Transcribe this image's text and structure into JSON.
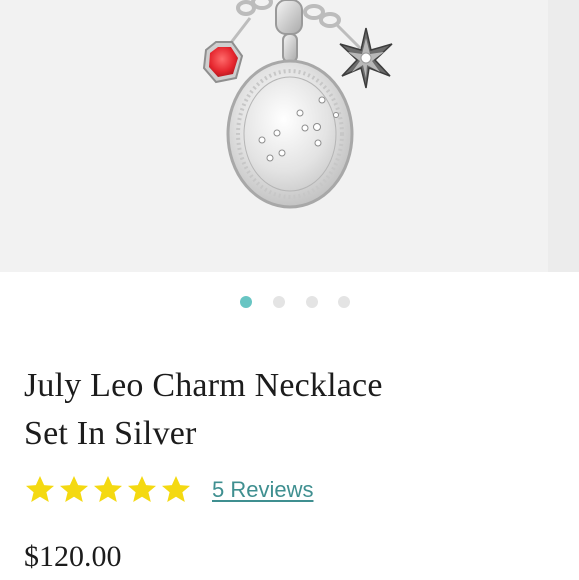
{
  "product": {
    "title_line1": "July Leo Charm Necklace",
    "title_line2": "Set In Silver",
    "price": "$120.00",
    "rating_value": 5,
    "rating_max": 5,
    "reviews_label": "5 Reviews",
    "image_description_icon": "necklace-image"
  },
  "carousel": {
    "total_slides": 4,
    "active_index": 0
  },
  "colors": {
    "accent": "#68c5c3",
    "star": "#f4d911",
    "link": "#3f8f90",
    "text": "#1c1c1c"
  }
}
